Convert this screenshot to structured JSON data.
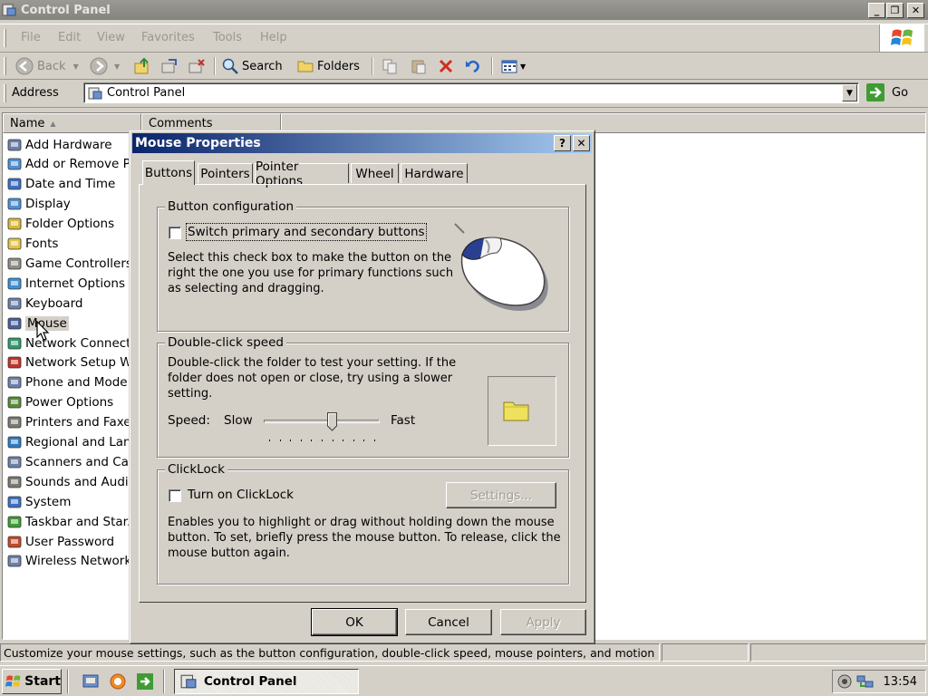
{
  "window": {
    "title": "Control Panel",
    "min_glyph": "_",
    "max_glyph": "❐",
    "close_glyph": "✕"
  },
  "menu": {
    "items": [
      "File",
      "Edit",
      "View",
      "Favorites",
      "Tools",
      "Help"
    ]
  },
  "toolbar": {
    "back_label": "Back",
    "search_label": "Search",
    "folders_label": "Folders"
  },
  "address": {
    "label": "Address",
    "value": "Control Panel",
    "go_label": "Go"
  },
  "list": {
    "columns": [
      "Name",
      "Comments"
    ],
    "items": [
      {
        "label": "Add Hardware",
        "icon": "hardware-icon"
      },
      {
        "label": "Add or Remove P...",
        "icon": "add-remove-programs-icon"
      },
      {
        "label": "Date and Time",
        "icon": "clock-icon"
      },
      {
        "label": "Display",
        "icon": "monitor-icon"
      },
      {
        "label": "Folder Options",
        "icon": "folder-options-icon"
      },
      {
        "label": "Fonts",
        "icon": "fonts-folder-icon"
      },
      {
        "label": "Game Controllers",
        "icon": "gamepad-icon"
      },
      {
        "label": "Internet Options",
        "icon": "globe-icon"
      },
      {
        "label": "Keyboard",
        "icon": "keyboard-icon"
      },
      {
        "label": "Mouse",
        "icon": "mouse-icon"
      },
      {
        "label": "Network Connect...",
        "icon": "network-icon"
      },
      {
        "label": "Network Setup W...",
        "icon": "network-setup-icon"
      },
      {
        "label": "Phone and Mode...",
        "icon": "phone-icon"
      },
      {
        "label": "Power Options",
        "icon": "power-icon"
      },
      {
        "label": "Printers and Faxes",
        "icon": "printer-icon"
      },
      {
        "label": "Regional and Lan...",
        "icon": "regional-globe-icon"
      },
      {
        "label": "Scanners and Ca...",
        "icon": "scanner-icon"
      },
      {
        "label": "Sounds and Audi...",
        "icon": "speaker-icon"
      },
      {
        "label": "System",
        "icon": "computer-icon"
      },
      {
        "label": "Taskbar and Star...",
        "icon": "taskbar-icon"
      },
      {
        "label": "User Password",
        "icon": "users-icon"
      },
      {
        "label": "Wireless Network...",
        "icon": "wireless-icon"
      }
    ],
    "selected_index": 9
  },
  "dialog": {
    "title": "Mouse Properties",
    "help_glyph": "?",
    "close_glyph": "✕",
    "tabs": [
      "Buttons",
      "Pointers",
      "Pointer Options",
      "Wheel",
      "Hardware"
    ],
    "active_tab": 0,
    "button_config": {
      "title": "Button configuration",
      "checkbox_label": "Switch primary and secondary buttons",
      "checked": false,
      "description_lines": [
        "Select this check box to make the button on the",
        "right the one you use for primary functions such",
        "as selecting and dragging."
      ]
    },
    "double_click": {
      "title": "Double-click speed",
      "description_lines": [
        "Double-click the folder to test your setting. If the",
        "folder does not open or close, try using a slower",
        "setting."
      ],
      "speed_label": "Speed:",
      "slow_label": "Slow",
      "fast_label": "Fast",
      "speed_fraction": 0.6,
      "tick_count": 11
    },
    "clicklock": {
      "title": "ClickLock",
      "checkbox_label": "Turn on ClickLock",
      "checked": false,
      "settings_label": "Settings...",
      "description_lines": [
        "Enables you to highlight or drag without holding down the mouse",
        "button. To set, briefly press the mouse button. To release, click the",
        "mouse button again."
      ]
    },
    "buttons": {
      "ok": "OK",
      "cancel": "Cancel",
      "apply": "Apply"
    }
  },
  "status": {
    "text": "Customize your mouse settings, such as the button configuration, double-click speed, mouse pointers, and motion spe"
  },
  "taskbar": {
    "start_label": "Start",
    "task_label": "Control Panel",
    "clock": "13:54"
  },
  "colors": {
    "dialog_title_start": "#0a246a",
    "dialog_title_end": "#a6caf0",
    "face": "#d4d0c8"
  }
}
